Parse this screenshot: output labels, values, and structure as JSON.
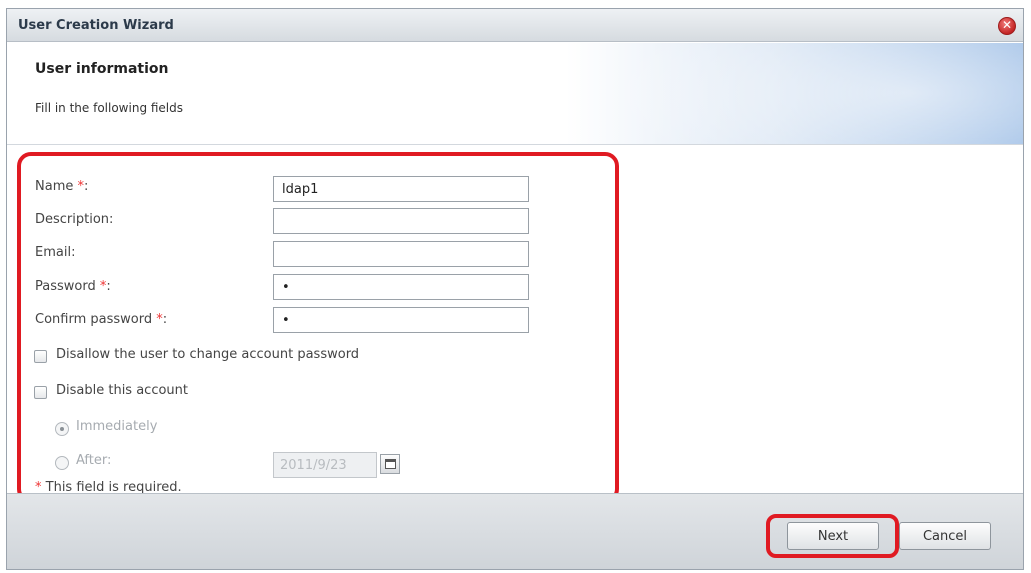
{
  "window": {
    "title": "User Creation Wizard",
    "close_glyph": "✕"
  },
  "header": {
    "title": "User information",
    "subtitle": "Fill in the following fields"
  },
  "form": {
    "name": {
      "label": "Name",
      "required_mark": "*",
      "suffix": ":",
      "value": "ldap1"
    },
    "description": {
      "label": "Description:",
      "value": ""
    },
    "email": {
      "label": "Email:",
      "value": ""
    },
    "password": {
      "label": "Password",
      "required_mark": "*",
      "suffix": ":",
      "value": "•"
    },
    "confirm_password": {
      "label": "Confirm password",
      "required_mark": "*",
      "suffix": ":",
      "value": "•"
    },
    "disallow_change": {
      "label": "Disallow the user to change account password",
      "checked": false
    },
    "disable_account": {
      "label": "Disable this account",
      "checked": false
    },
    "immediately": {
      "label": "Immediately",
      "selected": true
    },
    "after": {
      "label": "After:",
      "selected": false,
      "date": "2011/9/23"
    },
    "required_note": {
      "mark": "*",
      "text": "This field is required."
    }
  },
  "footer": {
    "next_label": "Next",
    "cancel_label": "Cancel"
  },
  "colors": {
    "required": "#e33333",
    "highlight": "#e01a22"
  },
  "icons": {
    "close": "close-icon",
    "calendar": "calendar-icon"
  }
}
